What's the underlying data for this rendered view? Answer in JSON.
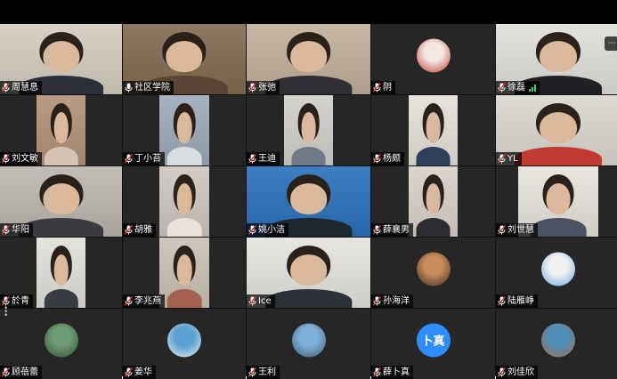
{
  "participants": [
    {
      "name": "周慧息",
      "type": "video",
      "framing": "full",
      "bg": "#d8d2c6",
      "shirt": "#2b2f3a"
    },
    {
      "name": "社区学院",
      "type": "video",
      "framing": "full",
      "bg": "#8e7a62",
      "shirt": "#5a4433",
      "active": true,
      "mic": "on"
    },
    {
      "name": "张弛",
      "type": "video",
      "framing": "full",
      "bg": "#c6b8a4",
      "shirt": "#2e2e33"
    },
    {
      "name": "阴",
      "type": "avatar",
      "avatar_colors": [
        "#f3e7e2",
        "#c0392b"
      ]
    },
    {
      "name": "徐磊",
      "type": "video",
      "framing": "full",
      "bg": "#e4e2de",
      "shirt": "#1f1f24",
      "signal": true,
      "tile_button": "more-icon"
    },
    {
      "name": "刘文敏",
      "type": "video",
      "framing": "narrow",
      "bg": "#b99c86",
      "shirt": "#d7c3b1"
    },
    {
      "name": "丁小苔",
      "type": "video",
      "framing": "narrow",
      "bg": "#a9b3bf",
      "shirt": "#d9dde2"
    },
    {
      "name": "王迪",
      "type": "video",
      "framing": "narrow",
      "bg": "#d6d4cf",
      "shirt": "#6e7a86"
    },
    {
      "name": "杨颇",
      "type": "video",
      "framing": "narrow",
      "bg": "#e7e3dd",
      "shirt": "#2e3f5a"
    },
    {
      "name": "YL",
      "type": "video",
      "framing": "full",
      "bg": "#dedbd5",
      "shirt": "#c23b32"
    },
    {
      "name": "华阳",
      "type": "video",
      "framing": "full",
      "bg": "#c2bdb6",
      "shirt": "#3c3b3f"
    },
    {
      "name": "胡雅",
      "type": "video",
      "framing": "narrow",
      "bg": "#d3ccc6",
      "shirt": "#e9e2da"
    },
    {
      "name": "姚小洁",
      "type": "video",
      "framing": "full",
      "bg": "#3d7fc2",
      "shirt": "#1e2630"
    },
    {
      "name": "薛襄男",
      "type": "video",
      "framing": "narrow",
      "bg": "#dcd6cf",
      "shirt": "#2c2c30"
    },
    {
      "name": "刘世慧",
      "type": "video",
      "framing": "mid",
      "bg": "#e9e6e0",
      "shirt": "#4b5363"
    },
    {
      "name": "於青",
      "type": "video",
      "framing": "narrow",
      "bg": "#e5e3de",
      "shirt": "#3a3c44"
    },
    {
      "name": "李兆燕",
      "type": "video",
      "framing": "narrow",
      "bg": "#cfc7bd",
      "shirt": "#a3614e"
    },
    {
      "name": "Ice",
      "type": "video",
      "framing": "full",
      "bg": "#e8e6e2",
      "shirt": "#2b2f36"
    },
    {
      "name": "孙海洋",
      "type": "avatar",
      "avatar_colors": [
        "#c98b5c",
        "#3a2a20"
      ]
    },
    {
      "name": "陆雁峥",
      "type": "avatar",
      "avatar_colors": [
        "#f0f0f0",
        "#6fa6e0"
      ]
    },
    {
      "name": "顾蓓蕾",
      "type": "avatar",
      "avatar_colors": [
        "#6f9a76",
        "#2f4f35"
      ]
    },
    {
      "name": "姜华",
      "type": "avatar",
      "avatar_colors": [
        "#5aa0d0",
        "#e8eef2"
      ]
    },
    {
      "name": "王利",
      "type": "avatar",
      "avatar_colors": [
        "#7fb2d8",
        "#3d5a70"
      ]
    },
    {
      "name": "薛卜真",
      "type": "initials",
      "initials": "卜真",
      "avatar_colors": [
        "#2d8cff",
        "#2d8cff"
      ]
    },
    {
      "name": "刘佳欣",
      "type": "avatar",
      "avatar_colors": [
        "#4f8fb8",
        "#a76c4a"
      ]
    }
  ],
  "colors": {
    "active_speaker": "#27c04a",
    "mic_muted": "#e0383a",
    "mic_on": "#ffffff",
    "name_tag_bg": "#000000",
    "initials_avatar": "#2d8cff"
  }
}
